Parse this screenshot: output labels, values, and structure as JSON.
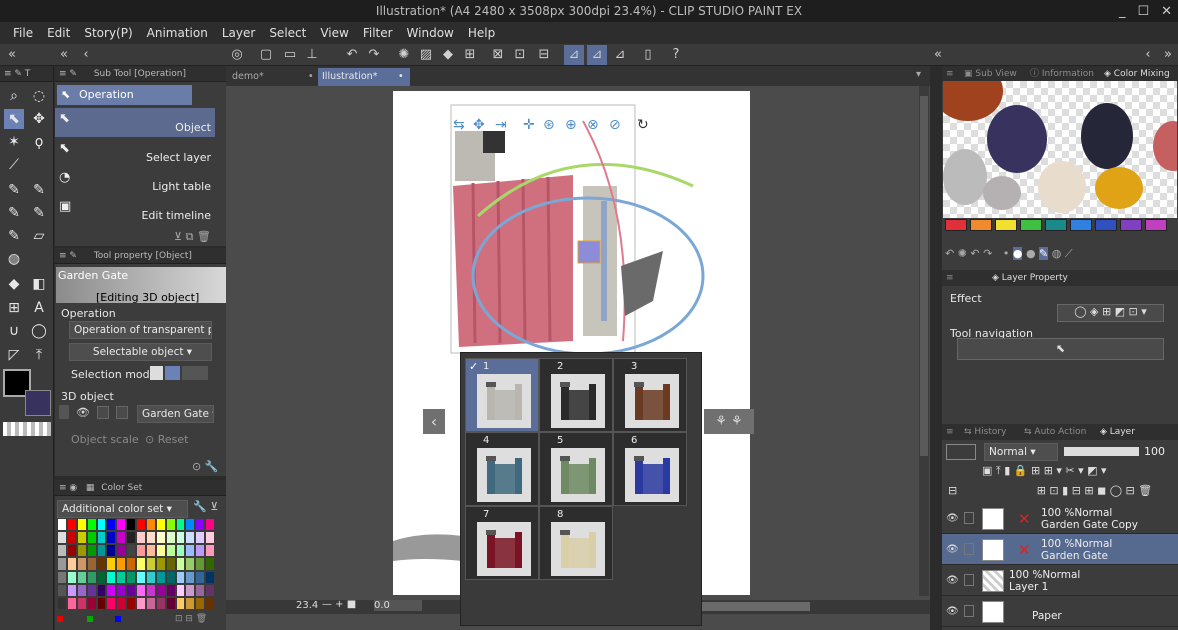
{
  "window": {
    "title": "Illustration* (A4 2480 x 3508px 300dpi 23.4%) - CLIP STUDIO PAINT EX",
    "minimize": "_",
    "maximize": "☐",
    "close": "✕"
  },
  "menu": [
    "File",
    "Edit",
    "Story(P)",
    "Animation",
    "Layer",
    "Select",
    "View",
    "Filter",
    "Window",
    "Help"
  ],
  "subtool": {
    "header": "Sub Tool [Operation]",
    "group": "Operation",
    "items": [
      {
        "label": "Object"
      },
      {
        "label": "Select layer"
      },
      {
        "label": "Light table"
      },
      {
        "label": "Edit timeline"
      }
    ]
  },
  "toolprop": {
    "header": "Tool property [Object]",
    "object_name": "Garden Gate",
    "editing": "[Editing 3D object]",
    "operation_label": "Operation",
    "operation_value": "Operation of transparent part",
    "selectable": "Selectable object",
    "selection_mode": "Selection mode",
    "obj3d_label": "3D object",
    "obj3d_value": "Garden Gate",
    "scale": "Object scale",
    "reset": "Reset"
  },
  "colorset": {
    "header": "Color Set",
    "set_name": "Additional color set"
  },
  "tabs": [
    {
      "label": "demo*"
    },
    {
      "label": "Illustration*"
    }
  ],
  "statusbar": {
    "zoom": "23.4",
    "angle": "0.0"
  },
  "variations": {
    "items": [
      {
        "num": "1",
        "color": "#b9b6b0"
      },
      {
        "num": "2",
        "color": "#2a2a2a"
      },
      {
        "num": "3",
        "color": "#6a3a22"
      },
      {
        "num": "4",
        "color": "#3f6a7d"
      },
      {
        "num": "5",
        "color": "#6d8a62"
      },
      {
        "num": "6",
        "color": "#2a3aa0"
      },
      {
        "num": "7",
        "color": "#7a1424"
      },
      {
        "num": "8",
        "color": "#d8cfa8"
      }
    ]
  },
  "right": {
    "tabs": [
      "Sub View",
      "Information",
      "Color Mixing"
    ],
    "layerprop_tab": "Layer Property",
    "effect": "Effect",
    "tool_nav": "Tool navigation",
    "layer_tabs": [
      "History",
      "Auto Action",
      "Layer"
    ],
    "blend": "Normal",
    "opacity": "100",
    "layers": [
      {
        "opacity": "100 %",
        "mode": "Normal",
        "name": "Garden Gate Copy"
      },
      {
        "opacity": "100 %",
        "mode": "Normal",
        "name": "Garden Gate"
      },
      {
        "opacity": "100 %",
        "mode": "Normal",
        "name": "Layer 1"
      },
      {
        "opacity": "",
        "mode": "",
        "name": "Paper"
      }
    ]
  },
  "palette_colors": [
    "#e0303a",
    "#f08a30",
    "#f2e030",
    "#40c040",
    "#1a8a8a",
    "#3080e0",
    "#3050c0",
    "#8040c0",
    "#c040c0"
  ]
}
